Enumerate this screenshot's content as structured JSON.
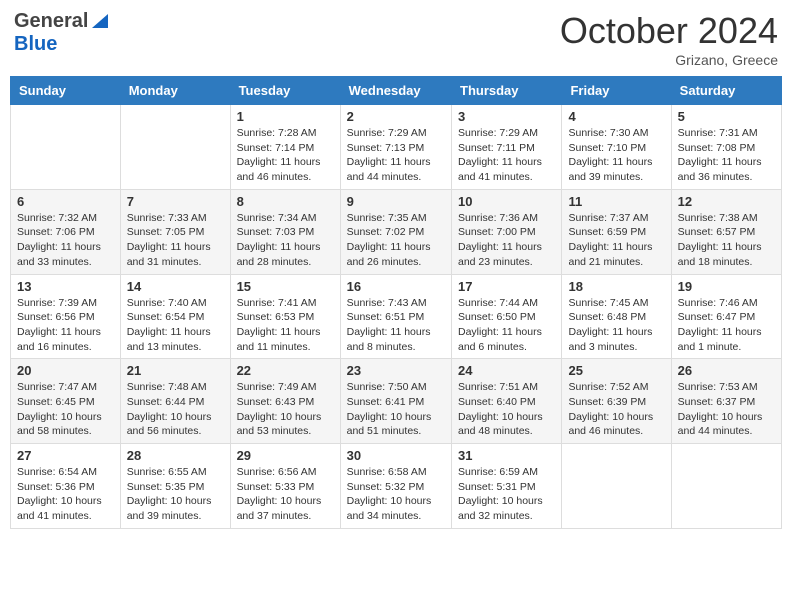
{
  "header": {
    "logo_general": "General",
    "logo_blue": "Blue",
    "month_title": "October 2024",
    "location": "Grizano, Greece"
  },
  "days_of_week": [
    "Sunday",
    "Monday",
    "Tuesday",
    "Wednesday",
    "Thursday",
    "Friday",
    "Saturday"
  ],
  "weeks": [
    [
      {
        "day": "",
        "info": ""
      },
      {
        "day": "",
        "info": ""
      },
      {
        "day": "1",
        "info": "Sunrise: 7:28 AM\nSunset: 7:14 PM\nDaylight: 11 hours and 46 minutes."
      },
      {
        "day": "2",
        "info": "Sunrise: 7:29 AM\nSunset: 7:13 PM\nDaylight: 11 hours and 44 minutes."
      },
      {
        "day": "3",
        "info": "Sunrise: 7:29 AM\nSunset: 7:11 PM\nDaylight: 11 hours and 41 minutes."
      },
      {
        "day": "4",
        "info": "Sunrise: 7:30 AM\nSunset: 7:10 PM\nDaylight: 11 hours and 39 minutes."
      },
      {
        "day": "5",
        "info": "Sunrise: 7:31 AM\nSunset: 7:08 PM\nDaylight: 11 hours and 36 minutes."
      }
    ],
    [
      {
        "day": "6",
        "info": "Sunrise: 7:32 AM\nSunset: 7:06 PM\nDaylight: 11 hours and 33 minutes."
      },
      {
        "day": "7",
        "info": "Sunrise: 7:33 AM\nSunset: 7:05 PM\nDaylight: 11 hours and 31 minutes."
      },
      {
        "day": "8",
        "info": "Sunrise: 7:34 AM\nSunset: 7:03 PM\nDaylight: 11 hours and 28 minutes."
      },
      {
        "day": "9",
        "info": "Sunrise: 7:35 AM\nSunset: 7:02 PM\nDaylight: 11 hours and 26 minutes."
      },
      {
        "day": "10",
        "info": "Sunrise: 7:36 AM\nSunset: 7:00 PM\nDaylight: 11 hours and 23 minutes."
      },
      {
        "day": "11",
        "info": "Sunrise: 7:37 AM\nSunset: 6:59 PM\nDaylight: 11 hours and 21 minutes."
      },
      {
        "day": "12",
        "info": "Sunrise: 7:38 AM\nSunset: 6:57 PM\nDaylight: 11 hours and 18 minutes."
      }
    ],
    [
      {
        "day": "13",
        "info": "Sunrise: 7:39 AM\nSunset: 6:56 PM\nDaylight: 11 hours and 16 minutes."
      },
      {
        "day": "14",
        "info": "Sunrise: 7:40 AM\nSunset: 6:54 PM\nDaylight: 11 hours and 13 minutes."
      },
      {
        "day": "15",
        "info": "Sunrise: 7:41 AM\nSunset: 6:53 PM\nDaylight: 11 hours and 11 minutes."
      },
      {
        "day": "16",
        "info": "Sunrise: 7:43 AM\nSunset: 6:51 PM\nDaylight: 11 hours and 8 minutes."
      },
      {
        "day": "17",
        "info": "Sunrise: 7:44 AM\nSunset: 6:50 PM\nDaylight: 11 hours and 6 minutes."
      },
      {
        "day": "18",
        "info": "Sunrise: 7:45 AM\nSunset: 6:48 PM\nDaylight: 11 hours and 3 minutes."
      },
      {
        "day": "19",
        "info": "Sunrise: 7:46 AM\nSunset: 6:47 PM\nDaylight: 11 hours and 1 minute."
      }
    ],
    [
      {
        "day": "20",
        "info": "Sunrise: 7:47 AM\nSunset: 6:45 PM\nDaylight: 10 hours and 58 minutes."
      },
      {
        "day": "21",
        "info": "Sunrise: 7:48 AM\nSunset: 6:44 PM\nDaylight: 10 hours and 56 minutes."
      },
      {
        "day": "22",
        "info": "Sunrise: 7:49 AM\nSunset: 6:43 PM\nDaylight: 10 hours and 53 minutes."
      },
      {
        "day": "23",
        "info": "Sunrise: 7:50 AM\nSunset: 6:41 PM\nDaylight: 10 hours and 51 minutes."
      },
      {
        "day": "24",
        "info": "Sunrise: 7:51 AM\nSunset: 6:40 PM\nDaylight: 10 hours and 48 minutes."
      },
      {
        "day": "25",
        "info": "Sunrise: 7:52 AM\nSunset: 6:39 PM\nDaylight: 10 hours and 46 minutes."
      },
      {
        "day": "26",
        "info": "Sunrise: 7:53 AM\nSunset: 6:37 PM\nDaylight: 10 hours and 44 minutes."
      }
    ],
    [
      {
        "day": "27",
        "info": "Sunrise: 6:54 AM\nSunset: 5:36 PM\nDaylight: 10 hours and 41 minutes."
      },
      {
        "day": "28",
        "info": "Sunrise: 6:55 AM\nSunset: 5:35 PM\nDaylight: 10 hours and 39 minutes."
      },
      {
        "day": "29",
        "info": "Sunrise: 6:56 AM\nSunset: 5:33 PM\nDaylight: 10 hours and 37 minutes."
      },
      {
        "day": "30",
        "info": "Sunrise: 6:58 AM\nSunset: 5:32 PM\nDaylight: 10 hours and 34 minutes."
      },
      {
        "day": "31",
        "info": "Sunrise: 6:59 AM\nSunset: 5:31 PM\nDaylight: 10 hours and 32 minutes."
      },
      {
        "day": "",
        "info": ""
      },
      {
        "day": "",
        "info": ""
      }
    ]
  ]
}
